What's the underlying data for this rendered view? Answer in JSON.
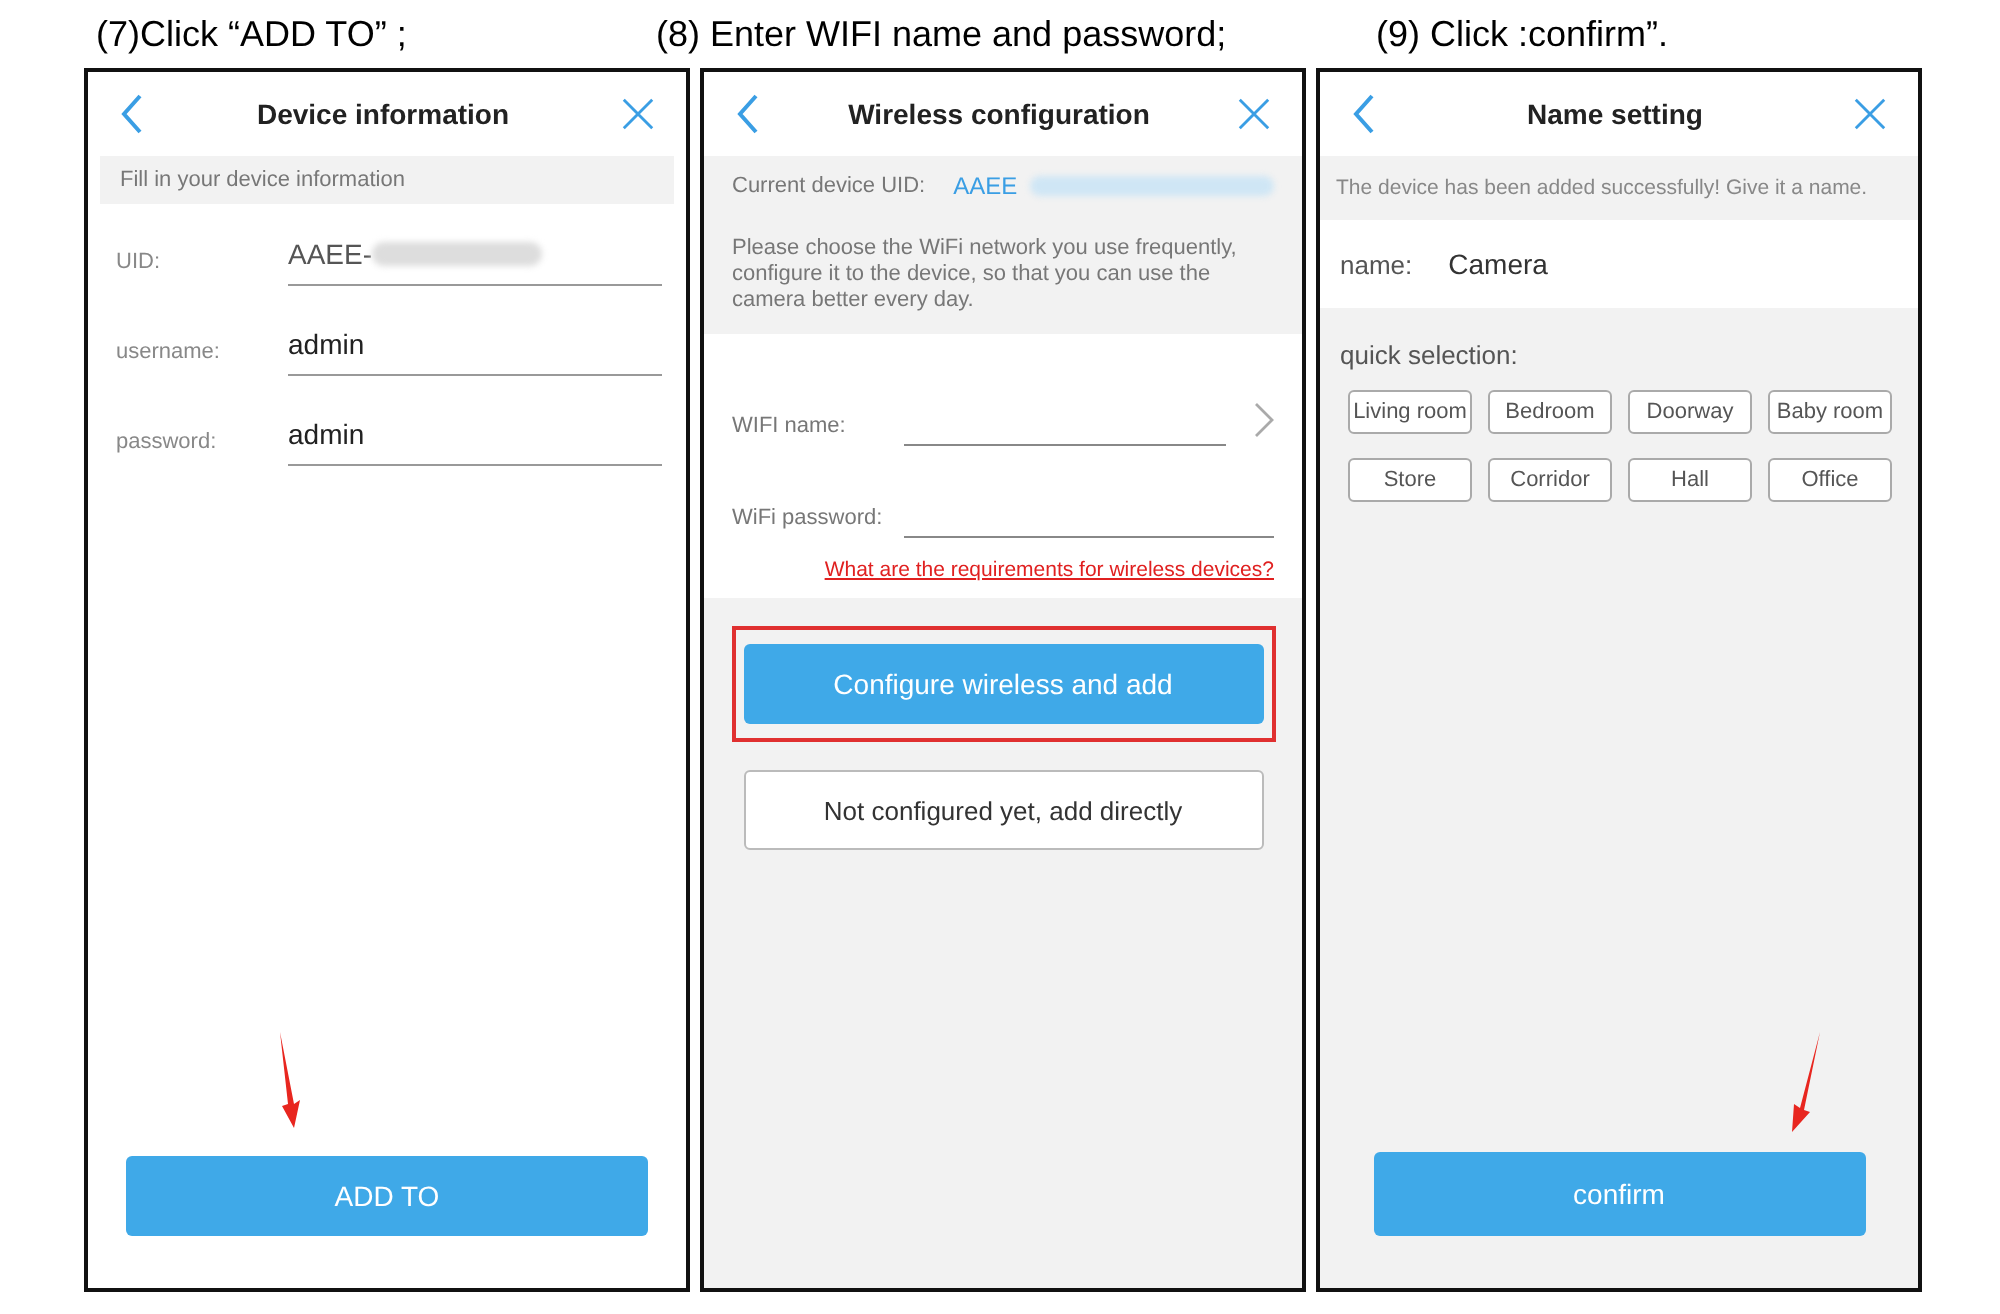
{
  "step1": {
    "caption": "(7)Click “ADD TO” ;",
    "title": "Device information",
    "hint": "Fill in your device information",
    "fields": [
      {
        "label": "UID:",
        "value": "AAEE-",
        "redacted": true
      },
      {
        "label": "username:",
        "value": "admin",
        "redacted": false
      },
      {
        "label": "password:",
        "value": "admin",
        "redacted": false
      }
    ],
    "button": "ADD TO"
  },
  "step2": {
    "caption": "(8) Enter WIFI name and password;",
    "title": "Wireless configuration",
    "uid_label": "Current device UID:",
    "uid_value": "AAEE",
    "intro": "Please choose the WiFi network you use frequently, configure it to the device, so that you can use the camera better every day.",
    "fields": [
      {
        "kind": "picker",
        "label": "WIFI name:"
      },
      {
        "kind": "text",
        "label": "WiFi password:"
      }
    ],
    "link": "What are the requirements for wireless devices?",
    "primary": "Configure wireless and add",
    "secondary": "Not configured yet, add directly"
  },
  "step3": {
    "caption": "(9) Click :confirm”.",
    "title": "Name setting",
    "notice": "The device has been added successfully! Give it a name.",
    "name_label": "name:",
    "name_value": "Camera",
    "quick_label": "quick selection:",
    "chips": [
      "Living room",
      "Bedroom",
      "Doorway",
      "Baby room",
      "Store",
      "Corridor",
      "Hall",
      "Office"
    ],
    "button": "confirm"
  }
}
